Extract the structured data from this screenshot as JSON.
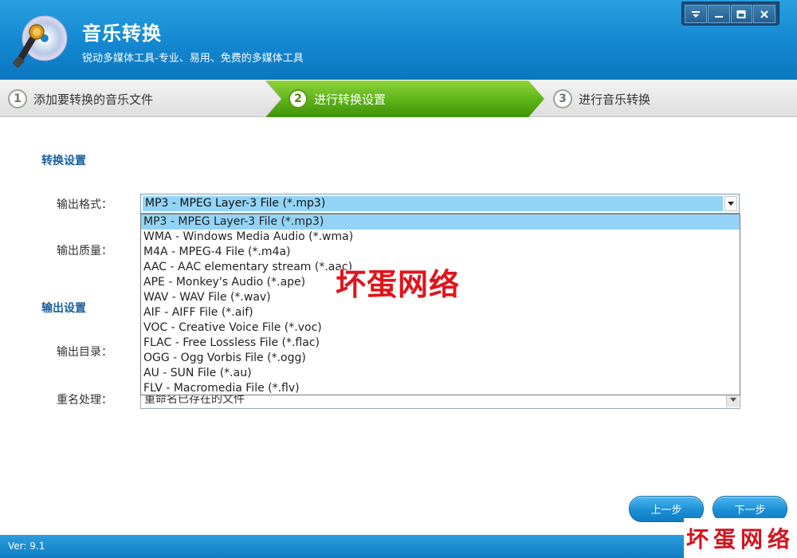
{
  "app": {
    "title": "音乐转换",
    "subtitle": "锐动多媒体工具-专业、易用、免费的多媒体工具",
    "logo_icon": "cd-microphone-icon"
  },
  "window_controls": [
    "menu-icon",
    "minimize-icon",
    "maximize-icon",
    "close-icon"
  ],
  "steps": [
    {
      "num": "1",
      "label": "添加要转换的音乐文件",
      "active": false
    },
    {
      "num": "2",
      "label": "进行转换设置",
      "active": true
    },
    {
      "num": "3",
      "label": "进行音乐转换",
      "active": false
    }
  ],
  "conversion_settings": {
    "title": "转换设置",
    "format_label": "输出格式：",
    "format_value": "MP3 - MPEG Layer-3 File (*.mp3)",
    "quality_label": "输出质量："
  },
  "output_settings": {
    "title": "输出设置",
    "dir_label": "输出目录：",
    "rename_label": "重名处理：",
    "rename_value": "重命名已存在的文件"
  },
  "format_options": [
    "MP3 - MPEG Layer-3 File (*.mp3)",
    "WMA - Windows Media Audio (*.wma)",
    "M4A - MPEG-4 File (*.m4a)",
    "AAC - AAC elementary stream (*.aac)",
    "APE - Monkey's Audio (*.ape)",
    "WAV - WAV File (*.wav)",
    "AIF - AIFF File (*.aif)",
    "VOC - Creative Voice File (*.voc)",
    "FLAC - Free Lossless File (*.flac)",
    "OGG - Ogg Vorbis File (*.ogg)",
    "AU - SUN File (*.au)",
    "FLV - Macromedia File (*.flv)"
  ],
  "buttons": {
    "prev": "上一步",
    "next": "下一步"
  },
  "footer": {
    "version": "Ver: 9.1"
  },
  "watermark": {
    "center": "坏蛋网络",
    "corner": "坏蛋网络"
  },
  "colors": {
    "header_blue": "#1487d1",
    "active_step_green": "#5fb51a",
    "section_title": "#1a5f9e",
    "selection": "#93d4f6"
  }
}
